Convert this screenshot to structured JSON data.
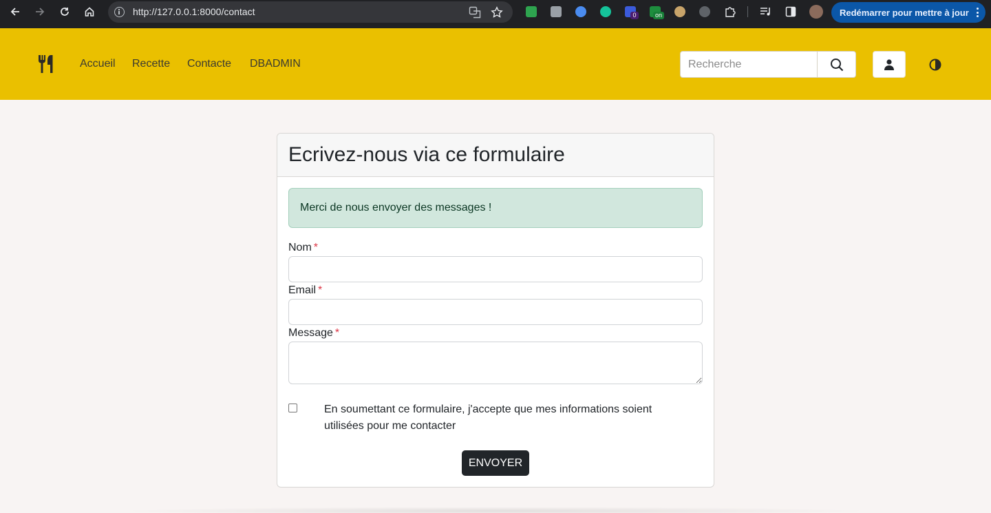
{
  "browser": {
    "url": "http://127.0.0.1:8000/contact",
    "update_button": "Redémarrer pour mettre à jour",
    "extensions": [
      "mail-ext",
      "notion-ext",
      "circle-ext",
      "grammarly-ext",
      "badge-0-ext",
      "on-ext",
      "tiger-ext",
      "gear-ext",
      "puzzle-ext"
    ],
    "ext_badges": {
      "badge_count": "0",
      "on_label": "on"
    }
  },
  "navbar": {
    "brand_icon": "utensils-icon",
    "links": [
      "Accueil",
      "Recette",
      "Contacte",
      "DBADMIN"
    ],
    "search_placeholder": "Recherche",
    "colors": {
      "background": "#eac000"
    }
  },
  "form": {
    "title": "Ecrivez-nous via ce formulaire",
    "alert": "Merci de nous envoyer des messages !",
    "name_label": "Nom",
    "email_label": "Email",
    "message_label": "Message",
    "required_mark": "*",
    "name_value": "",
    "email_value": "",
    "message_value": "",
    "consent_text": "En soumettant ce formulaire, j'accepte que mes informations soient utilisées pour me contacter",
    "submit_label": "ENVOYER"
  }
}
